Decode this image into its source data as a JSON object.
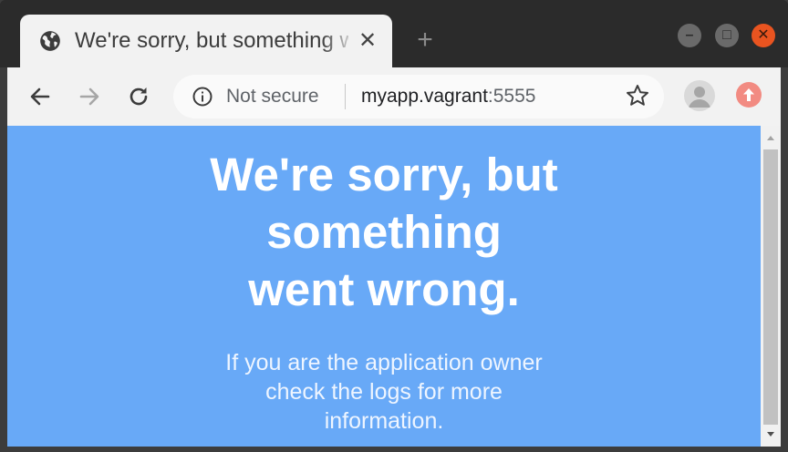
{
  "tab": {
    "title": "We're sorry, but something went wrong",
    "close_glyph": "✕",
    "new_tab_glyph": "+",
    "favicon": "globe-icon"
  },
  "window_controls": {
    "minimize_glyph": "–",
    "maximize_glyph": "□",
    "close_glyph": "✕",
    "close_color": "#e95420"
  },
  "toolbar": {
    "back_icon": "arrow-left-icon",
    "forward_icon": "arrow-right-icon",
    "reload_icon": "reload-icon",
    "security_icon": "info-icon",
    "security_label": "Not secure",
    "url_host": "myapp.vagrant",
    "url_port": ":5555",
    "bookmark_icon": "star-icon",
    "profile_icon": "avatar-icon",
    "update_icon": "update-arrow-icon",
    "update_color": "#f28b82"
  },
  "page": {
    "background": "#68a9f7",
    "heading_lines": [
      "We're sorry, but",
      "something",
      "went wrong."
    ],
    "body_lines": [
      "If you are the application owner",
      "check the logs for more",
      "information."
    ]
  },
  "scrollbar": {
    "up_icon": "scroll-up-arrow-icon",
    "down_icon": "scroll-down-arrow-icon"
  }
}
